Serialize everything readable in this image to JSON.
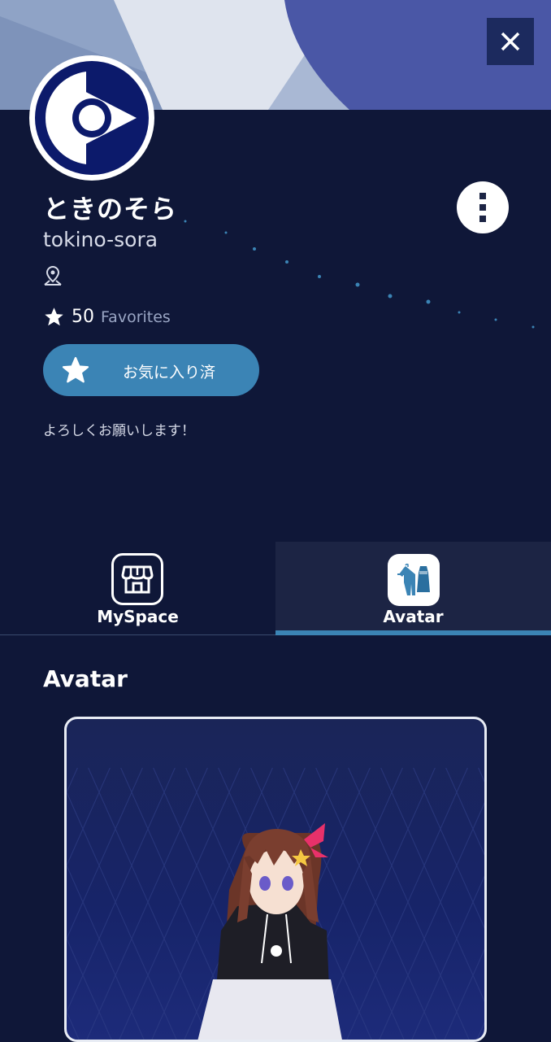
{
  "profile": {
    "display_name": "ときのそら",
    "user_id": "tokino-sora",
    "favorites_count": "50",
    "favorites_label": "Favorites",
    "favorite_button_label": "お気に入り済",
    "bio": "よろしくお願いします！"
  },
  "tabs": [
    {
      "label": "MySpace",
      "icon": "store-icon",
      "selected": false
    },
    {
      "label": "Avatar",
      "icon": "clothing-icon",
      "selected": true
    }
  ],
  "section": {
    "title": "Avatar"
  },
  "colors": {
    "background": "#0f1738",
    "accent": "#3b84b5",
    "tab_selected_bg": "#1c2444"
  },
  "icons": {
    "close": "close-icon",
    "more": "vertical-dots-icon",
    "location": "map-pin-icon",
    "star": "star-icon"
  }
}
